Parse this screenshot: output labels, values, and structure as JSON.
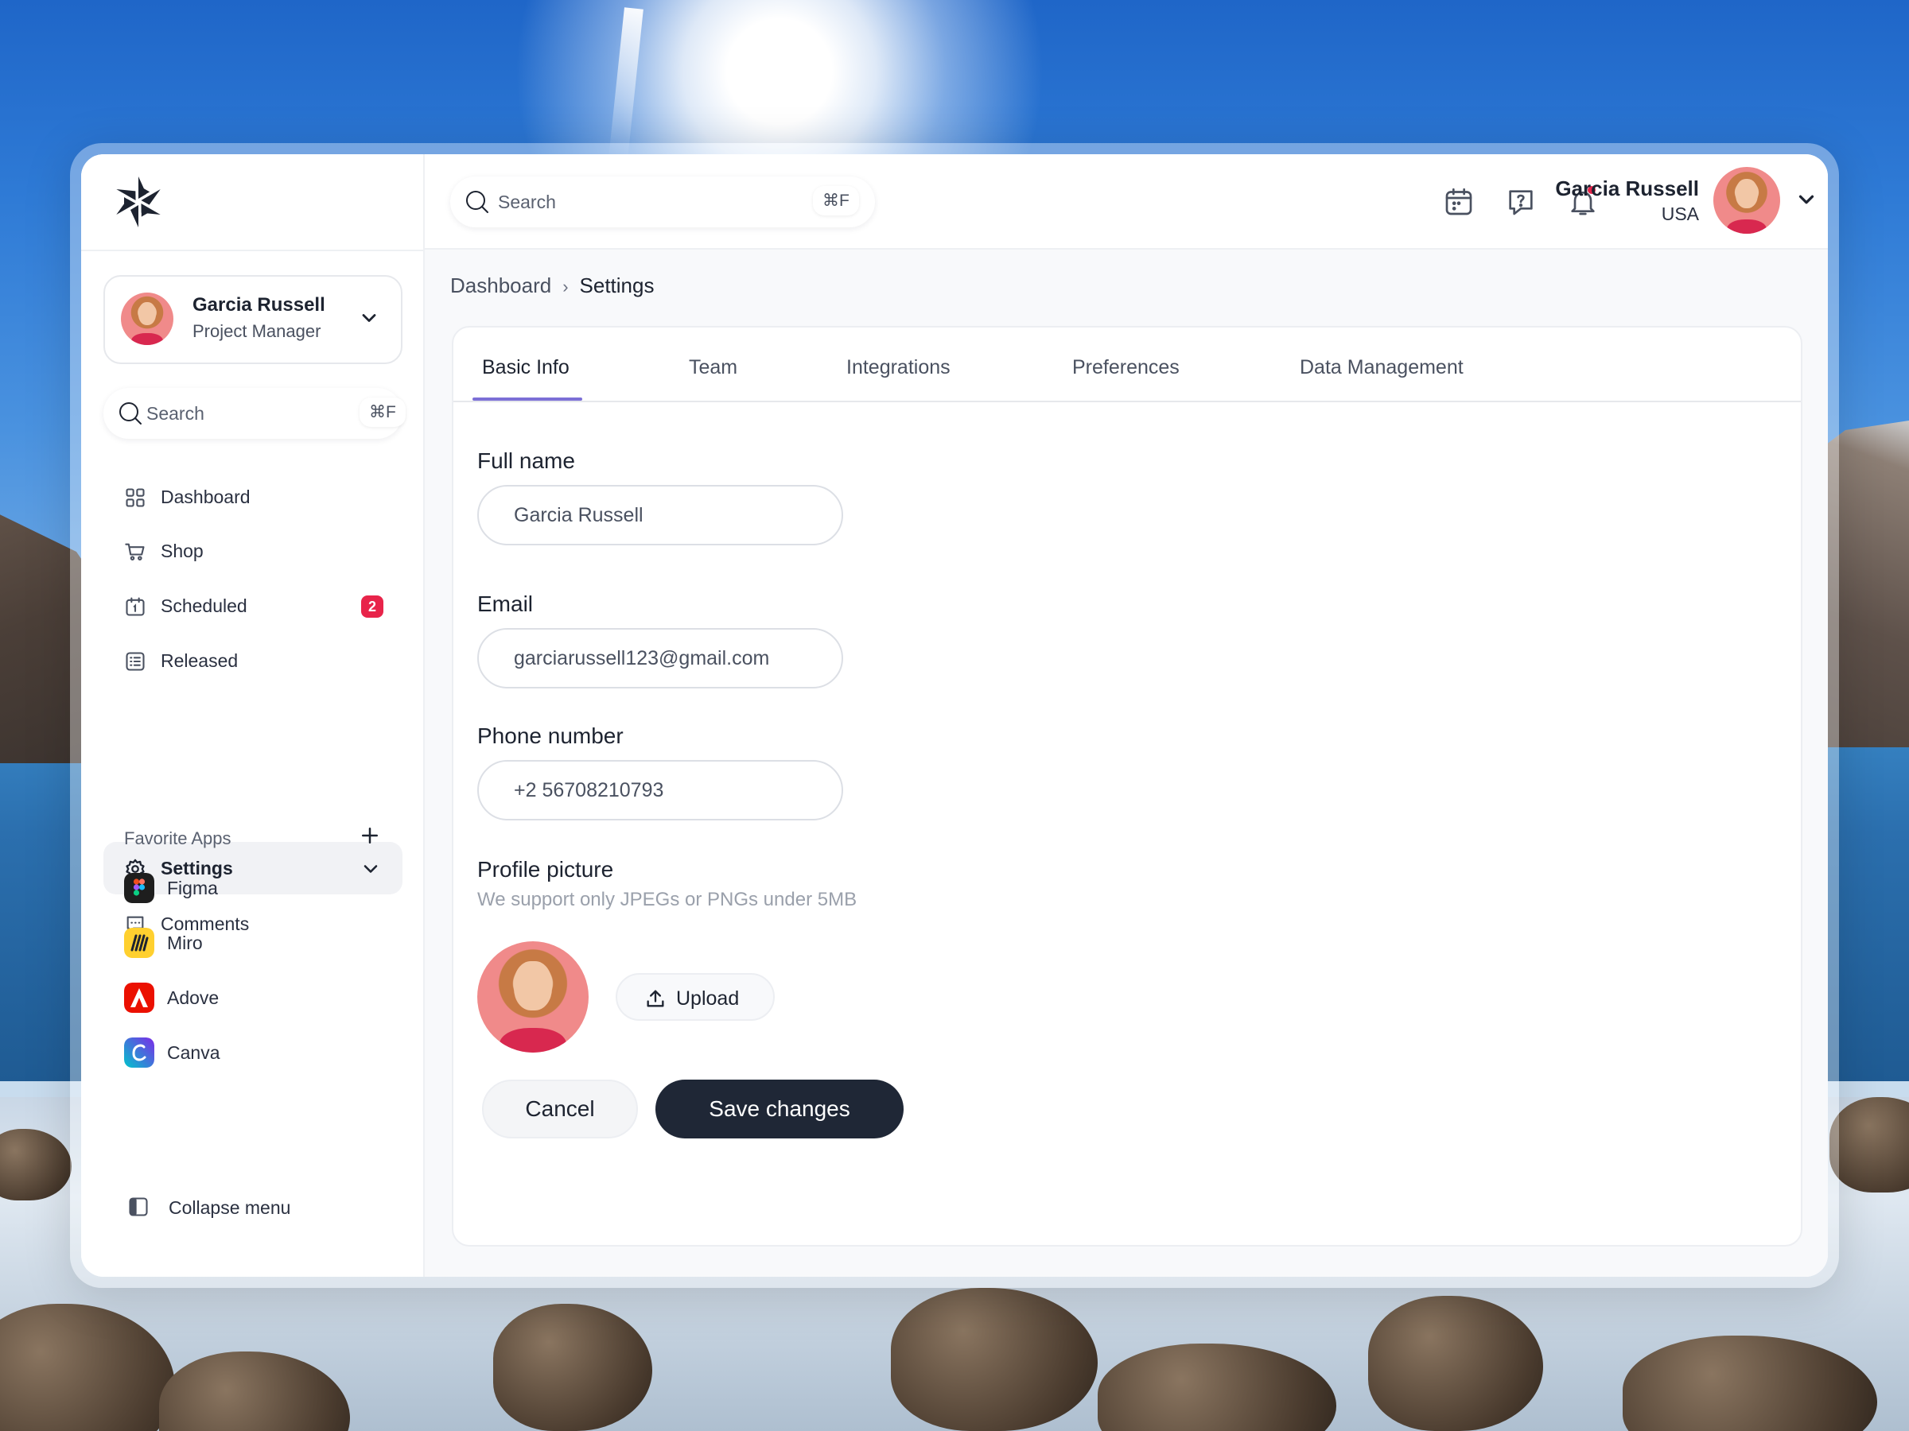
{
  "sidebar": {
    "profile": {
      "name": "Garcia Russell",
      "role": "Project Manager"
    },
    "search": {
      "placeholder": "Search",
      "shortcut": "⌘F"
    },
    "nav": [
      {
        "label": "Dashboard",
        "icon": "grid-icon"
      },
      {
        "label": "Shop",
        "icon": "cart-icon"
      },
      {
        "label": "Scheduled",
        "icon": "calendar-icon",
        "badge": "2"
      },
      {
        "label": "Released",
        "icon": "list-icon"
      },
      {
        "label": "Settings",
        "icon": "gear-icon",
        "active": true
      },
      {
        "label": "Comments",
        "icon": "comment-icon"
      }
    ],
    "favorites_title": "Favorite Apps",
    "apps": [
      {
        "label": "Figma",
        "icon": "figma-icon",
        "color": "#1e1e1e"
      },
      {
        "label": "Miro",
        "icon": "miro-icon",
        "color": "#ffd02f"
      },
      {
        "label": "Adove",
        "icon": "adobe-icon",
        "color": "#eb1000"
      },
      {
        "label": "Canva",
        "icon": "canva-icon",
        "color": "#00c4cc"
      }
    ],
    "collapse_label": "Collapse menu"
  },
  "topbar": {
    "search": {
      "placeholder": "Search",
      "shortcut": "⌘F"
    },
    "user": {
      "name": "Garcia Russell",
      "country": "USA"
    }
  },
  "breadcrumb": {
    "items": [
      "Dashboard",
      "Settings"
    ]
  },
  "tabs": [
    "Basic Info",
    "Team",
    "Integrations",
    "Preferences",
    "Data Management"
  ],
  "active_tab": "Basic Info",
  "form": {
    "full_name": {
      "label": "Full name",
      "value": "Garcia Russell"
    },
    "email": {
      "label": "Email",
      "value": "garciarussell123@gmail.com"
    },
    "phone": {
      "label": "Phone number",
      "value": "+2 56708210793"
    },
    "picture": {
      "label": "Profile picture",
      "help": "We support only JPEGs or PNGs under 5MB",
      "upload_label": "Upload"
    },
    "cancel_label": "Cancel",
    "save_label": "Save changes"
  },
  "colors": {
    "accent": "#7c6fd6",
    "primary_button": "#1f2736",
    "badge": "#e8244a"
  }
}
